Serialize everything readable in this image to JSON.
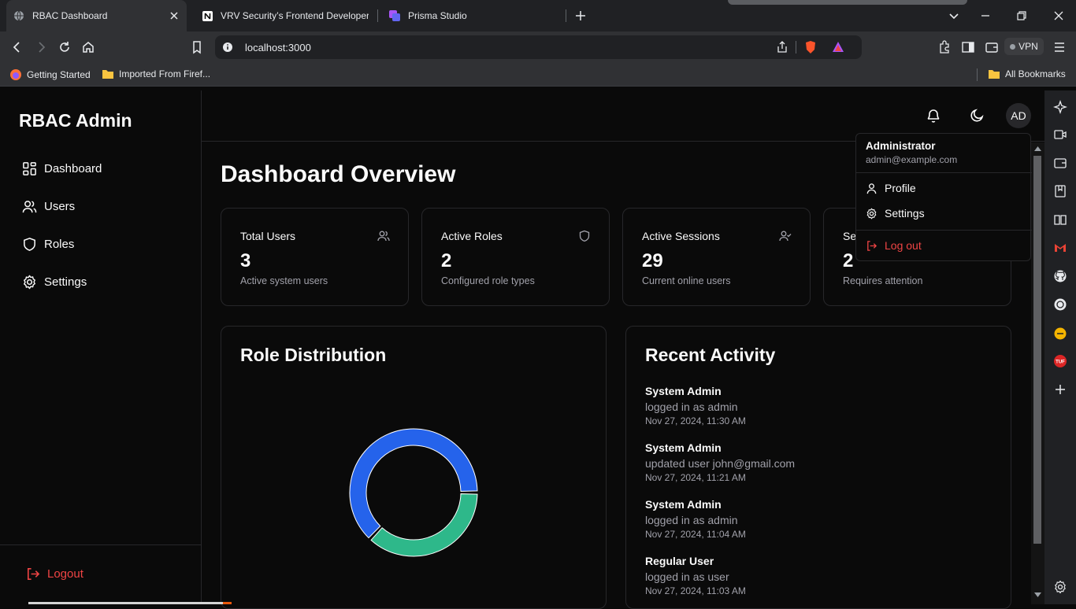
{
  "browser": {
    "tabs": [
      {
        "title": "RBAC Dashboard",
        "active": true
      },
      {
        "title": "VRV Security’s Frontend Developer I",
        "active": false
      },
      {
        "title": "Prisma Studio",
        "active": false
      }
    ],
    "url": "localhost:3000",
    "vpn_label": "VPN",
    "bookmarks": [
      {
        "label": "Getting Started",
        "icon": "firefox-icon"
      },
      {
        "label": "Imported From Firef...",
        "icon": "folder-icon"
      }
    ],
    "all_bookmarks": "All Bookmarks"
  },
  "app": {
    "brand": "RBAC Admin",
    "nav": [
      {
        "label": "Dashboard",
        "icon": "grid-icon"
      },
      {
        "label": "Users",
        "icon": "users-icon"
      },
      {
        "label": "Roles",
        "icon": "shield-icon"
      },
      {
        "label": "Settings",
        "icon": "gear-icon"
      }
    ],
    "logout": "Logout",
    "avatar_initials": "AD",
    "page_title": "Dashboard Overview",
    "stats": [
      {
        "title": "Total Users",
        "value": "3",
        "sub": "Active system users",
        "icon": "users-icon"
      },
      {
        "title": "Active Roles",
        "value": "2",
        "sub": "Configured role types",
        "icon": "shield-icon"
      },
      {
        "title": "Active Sessions",
        "value": "29",
        "sub": "Current online users",
        "icon": "user-check-icon"
      },
      {
        "title": "Se",
        "value": "2",
        "sub": "Requires attention",
        "icon": ""
      }
    ],
    "role_distribution": {
      "title": "Role Distribution"
    },
    "recent_activity": {
      "title": "Recent Activity",
      "items": [
        {
          "user": "System Admin",
          "action": "logged in as admin",
          "time": "Nov 27, 2024, 11:30 AM"
        },
        {
          "user": "System Admin",
          "action": "updated user john@gmail.com",
          "time": "Nov 27, 2024, 11:21 AM"
        },
        {
          "user": "System Admin",
          "action": "logged in as admin",
          "time": "Nov 27, 2024, 11:04 AM"
        },
        {
          "user": "Regular User",
          "action": "logged in as user",
          "time": "Nov 27, 2024, 11:03 AM"
        }
      ]
    },
    "user_menu": {
      "name": "Administrator",
      "email": "admin@example.com",
      "items": [
        {
          "label": "Profile",
          "icon": "user-icon"
        },
        {
          "label": "Settings",
          "icon": "gear-icon"
        }
      ],
      "logout": "Log out"
    }
  },
  "chart_data": {
    "type": "pie",
    "donut": true,
    "slices": [
      {
        "value": 0.63,
        "color": "#2563eb"
      },
      {
        "value": 0.37,
        "color": "#2eb88a"
      }
    ]
  },
  "colors": {
    "background": "#0a0a0a",
    "border": "#27272a",
    "muted_text": "#a1a1aa",
    "danger": "#ef4444",
    "chart_blue": "#2563eb",
    "chart_green": "#2eb88a"
  }
}
